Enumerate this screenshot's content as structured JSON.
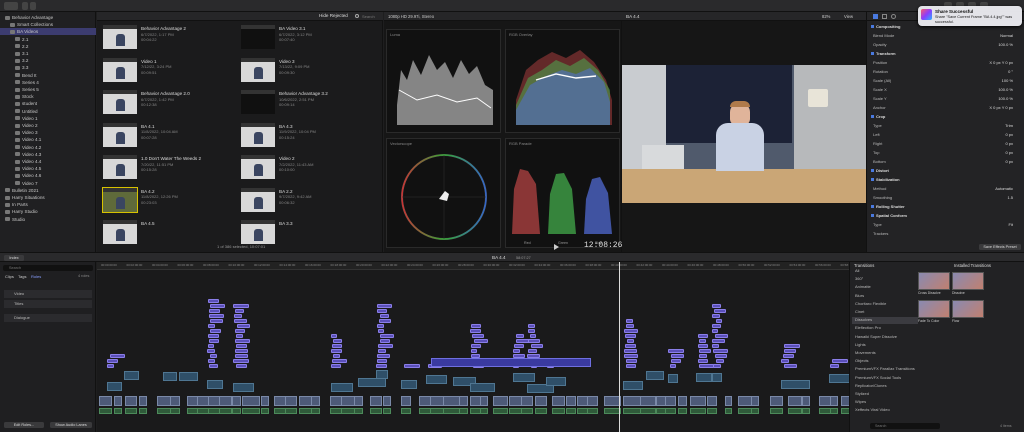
{
  "app": {
    "tab": "Hide Rejected",
    "viewer_info": "1080p HD 29.97i, Stereo",
    "project": "BA 4.4",
    "zoom": "82%",
    "view": "View",
    "timecode": "12:08:26",
    "selection": "1 of 386 selected, 10:07:01",
    "timeline_name": "BA 4.4",
    "timeline_duration": "58:07:27",
    "index_label": "Index",
    "clips_tab": "Clips",
    "tags_tab": "Tags",
    "roles_tab": "Roles",
    "search_placeholder": "Search"
  },
  "library": {
    "items": [
      {
        "label": "Behavior Advantage",
        "level": 0
      },
      {
        "label": "Smart Collections",
        "level": 1
      },
      {
        "label": "BA Videos",
        "level": 1,
        "selected": true
      },
      {
        "label": "2.1",
        "level": 2
      },
      {
        "label": "2.2",
        "level": 2
      },
      {
        "label": "3.1",
        "level": 2
      },
      {
        "label": "3.2",
        "level": 2
      },
      {
        "label": "3.3",
        "level": 2
      },
      {
        "label": "Bend It",
        "level": 2
      },
      {
        "label": "Series 4",
        "level": 2
      },
      {
        "label": "Series 5",
        "level": 2
      },
      {
        "label": "Stock",
        "level": 2
      },
      {
        "label": "student",
        "level": 2
      },
      {
        "label": "Untitled",
        "level": 2
      },
      {
        "label": "Video 1",
        "level": 2
      },
      {
        "label": "Video 2",
        "level": 2
      },
      {
        "label": "Video 3",
        "level": 2
      },
      {
        "label": "Video 4.1",
        "level": 2
      },
      {
        "label": "Video 4.2",
        "level": 2
      },
      {
        "label": "Video 4.3",
        "level": 2
      },
      {
        "label": "Video 4.4",
        "level": 2
      },
      {
        "label": "Video 4.5",
        "level": 2
      },
      {
        "label": "Video 4.6",
        "level": 2
      },
      {
        "label": "Video 7",
        "level": 2
      },
      {
        "label": "Bulletin 2021",
        "level": 0
      },
      {
        "label": "Harry Situations",
        "level": 0
      },
      {
        "label": "In Parts",
        "level": 0
      },
      {
        "label": "Harry Studio",
        "level": 0
      },
      {
        "label": "Studio",
        "level": 0
      }
    ]
  },
  "clips": [
    {
      "name": "Behavior Advantage 2",
      "meta": "6/7/2022, 1:17 PM",
      "dur": "00:04:22",
      "kind": "person"
    },
    {
      "name": "BA Video 3.1",
      "meta": "6/7/2022, 3:12 PM",
      "dur": "00:07:40",
      "kind": "dark"
    },
    {
      "name": "Video 1",
      "meta": "7/12/22, 3:24 PM",
      "dur": "00:09:51",
      "kind": "person"
    },
    {
      "name": "Video 3",
      "meta": "7/13/22, 9:09 PM",
      "dur": "00:09:30",
      "kind": "person"
    },
    {
      "name": "Behavior Advantage 2.0",
      "meta": "6/7/2022, 1:42 PM",
      "dur": "00:12:38",
      "kind": "person"
    },
    {
      "name": "Behavior Advantage 3.2",
      "meta": "10/6/2022, 2:51 PM",
      "dur": "00:09:14",
      "kind": "dark"
    },
    {
      "name": "BA 4.1",
      "meta": "11/8/2022, 10:04 AM",
      "dur": "00:07:28",
      "kind": "person"
    },
    {
      "name": "BA 4.3",
      "meta": "11/9/2022, 10:04 PM",
      "dur": "00:15:24",
      "kind": "person"
    },
    {
      "name": "1.0 Don't Water The Weeds 2",
      "meta": "7/20/22, 11:51 PM",
      "dur": "00:15:28",
      "kind": "person"
    },
    {
      "name": "Video 2",
      "meta": "7/2/2022, 11:43 AM",
      "dur": "00:10:00",
      "kind": "person"
    },
    {
      "name": "BA 4.2",
      "meta": "11/8/2022, 12:26 PM",
      "dur": "00:23:03",
      "kind": "gold"
    },
    {
      "name": "BA 2.2",
      "meta": "9/7/2022, 9:42 AM",
      "dur": "00:06:32",
      "kind": "person"
    },
    {
      "name": "BA 4.5",
      "meta": "",
      "dur": "",
      "kind": "person"
    },
    {
      "name": "BA 3.3",
      "meta": "",
      "dur": "",
      "kind": "person"
    }
  ],
  "scopes": {
    "luma": "Luma",
    "rgb": "RGB Overlay",
    "vector": "Vectorscope",
    "parade": "RGB Parade",
    "parade_labels": [
      "Red",
      "Green",
      "Blue"
    ]
  },
  "inspector": {
    "rows": [
      {
        "k": "Compositing",
        "v": "",
        "sec": true
      },
      {
        "k": "Blend Mode",
        "v": "Normal"
      },
      {
        "k": "Opacity",
        "v": "100.0 %"
      },
      {
        "k": "Transform",
        "v": "",
        "sec": true
      },
      {
        "k": "Position",
        "v": "X 0 px  Y 0 px"
      },
      {
        "k": "Rotation",
        "v": "0 °"
      },
      {
        "k": "Scale (All)",
        "v": "100 %"
      },
      {
        "k": "Scale X",
        "v": "100.0 %"
      },
      {
        "k": "Scale Y",
        "v": "100.0 %"
      },
      {
        "k": "Anchor",
        "v": "X 0 px  Y 0 px"
      },
      {
        "k": "Crop",
        "v": "",
        "sec": true
      },
      {
        "k": "Type",
        "v": "Trim"
      },
      {
        "k": "Left",
        "v": "0 px"
      },
      {
        "k": "Right",
        "v": "0 px"
      },
      {
        "k": "Top",
        "v": "0 px"
      },
      {
        "k": "Bottom",
        "v": "0 px"
      },
      {
        "k": "Distort",
        "v": "",
        "sec": true
      },
      {
        "k": "Stabilization",
        "v": "",
        "sec": true
      },
      {
        "k": "Method",
        "v": "Automatic"
      },
      {
        "k": "Smoothing",
        "v": "1.5"
      },
      {
        "k": "Rolling Shutter",
        "v": "",
        "sec": true
      },
      {
        "k": "Spatial Conform",
        "v": "",
        "sec": true
      },
      {
        "k": "Type",
        "v": "Fit"
      },
      {
        "k": "Trackers",
        "v": ""
      }
    ],
    "save_label": "Save Effects Preset"
  },
  "transitions": {
    "header": "Transitions",
    "installed": "Installed Transitions",
    "categories": [
      "All",
      "360°",
      "Animatte",
      "Blurs",
      "Choritaro Flexible",
      "Cinet",
      "Dissolves",
      "Eleflection Pro",
      "Hawaiki Super Dissolve",
      "Lights",
      "Movements",
      "Objects",
      "PremiumVFX Parallax Transitions",
      "PremiumVFX Social Tools",
      "Replicator/Clones",
      "Stylized",
      "Wipes",
      "Xeffects Viral Video"
    ],
    "selected": "Dissolves",
    "thumbs": [
      "Cross Dissolve",
      "Dissolve",
      "Fade To Color",
      "Flow"
    ],
    "count": "4 items"
  },
  "index": {
    "rows": [
      "Video",
      "Titles",
      "Dialogue"
    ],
    "count": "4 roles",
    "edit_roles": "Edit Roles...",
    "show_lanes": "Show Audio Lanes"
  },
  "banner": {
    "title": "Share Successful",
    "body": "Share \"Save Current Frame \"BA 4.4.jpg\"\" was successful."
  },
  "timeline": {
    "ruler": [
      "00:00:00:00",
      "00:02:00:00",
      "00:04:00:00",
      "00:06:00:00",
      "00:08:00:00",
      "00:10:00:00",
      "00:12:00:00",
      "00:14:00:00",
      "00:16:00:00",
      "00:18:00:00",
      "00:20:00:00",
      "00:22:00:00",
      "00:24:00:00",
      "00:26:00:00",
      "00:28:00:00",
      "00:30:00:00",
      "00:32:00:00",
      "00:34:00:00",
      "00:36:00:00",
      "00:38:00:00",
      "00:40:00:00",
      "00:42:00:00",
      "00:44:00:00",
      "00:46:00:00",
      "00:48:00:00",
      "00:50:00:00",
      "00:52:00:00",
      "00:54:00:00",
      "00:56:00:00",
      "00:58:00:00"
    ],
    "clip_label": "BA 4.4"
  }
}
